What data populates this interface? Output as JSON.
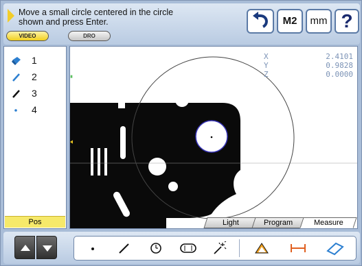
{
  "prompt": {
    "line1": "Move a small circle centered in the circle",
    "line2": "shown and press Enter."
  },
  "mode_buttons": {
    "video_label": "VIDEO",
    "dro_label": "DRO"
  },
  "top_buttons": {
    "undo_icon": "undo-arrow-icon",
    "m2_label": "M2",
    "units_label": "mm",
    "help_label": "?"
  },
  "feature_list": [
    {
      "num": "1",
      "icon": "probe-icon"
    },
    {
      "num": "2",
      "icon": "line-icon"
    },
    {
      "num": "3",
      "icon": "line-icon"
    },
    {
      "num": "4",
      "icon": "point-icon"
    }
  ],
  "pos_label": "Pos",
  "dro": {
    "x_label": "X",
    "x_value": "2.4101",
    "y_label": "Y",
    "y_value": "0.9828",
    "z_label": "Z",
    "z_value": "0.0000"
  },
  "tabs": {
    "light": "Light",
    "program": "Program",
    "measure": "Measure"
  },
  "toolbar": {
    "tools": [
      "point-icon",
      "line-icon",
      "circle-icon",
      "slot-icon",
      "magic-wand-icon",
      "angle-icon",
      "distance-icon",
      "skew-icon"
    ]
  },
  "colors": {
    "accent_yellow": "#f0cf1e",
    "panel_blue": "#a9bdd8",
    "dro_text": "#7c93b6",
    "probe_blue": "#2c7fd0"
  }
}
